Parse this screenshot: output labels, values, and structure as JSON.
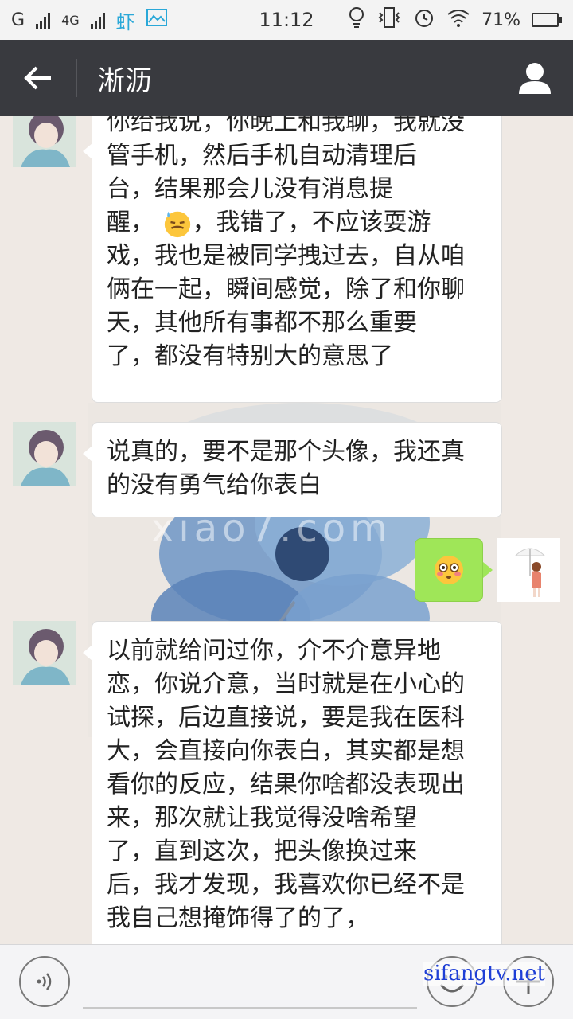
{
  "status_bar": {
    "carrier1": "G",
    "network": "4G",
    "app_glyph": "虾",
    "time": "11:12",
    "battery": "71%",
    "battery_level": 0.71,
    "icons": [
      "signal-icon",
      "app-icon",
      "image-icon",
      "bulb-icon",
      "vibrate-icon",
      "alarm-icon",
      "wifi-icon",
      "battery-icon"
    ]
  },
  "header": {
    "title": "淅沥",
    "back_icon": "arrow-left-icon",
    "profile_icon": "person-icon"
  },
  "background": {
    "watermark": "xiao7.com"
  },
  "messages": [
    {
      "side": "left",
      "lines": [
        "你给我说，你晚上和我聊，我就没",
        "管手机，然后手机自动清理后",
        "台，结果那会儿没有消息提",
        "醒，",
        "，我错了，不应该耍游",
        "戏，我也是被同学拽过去，自从咱",
        "俩在一起，瞬间感觉，除了和你聊",
        "天，其他所有事都不那么重要",
        "了，都没有特别大的意思了"
      ],
      "emoji": "downcast-sweat-emoji"
    },
    {
      "side": "left",
      "lines": [
        "说真的，要不是那个头像，我还真",
        "的没有勇气给你表白"
      ]
    },
    {
      "side": "right",
      "emoji": "flushed-face-emoji"
    },
    {
      "side": "left",
      "lines": [
        "以前就给问过你，介不介意异地",
        "恋，你说介意，当时就是在小心的",
        "试探，后边直接说，要是我在医科",
        "大，会直接向你表白，其实都是想",
        "看你的反应，结果你啥都没表现出",
        "来，那次就让我觉得没啥希望",
        "了，直到这次，把头像换过来",
        "后，我才发现，我喜欢你已经不是",
        "我自己想掩饰得了的了，"
      ]
    }
  ],
  "input_bar": {
    "voice_icon": "voice-icon",
    "emoji_icon": "emoji-icon",
    "plus_icon": "plus-icon",
    "site_watermark": "sifangtv.net"
  },
  "colors": {
    "header_bg": "#393a3f",
    "chat_bg": "#efe9e4",
    "bubble_left": "#ffffff",
    "bubble_right": "#9fe658",
    "site_watermark": "#1f3fd6"
  }
}
